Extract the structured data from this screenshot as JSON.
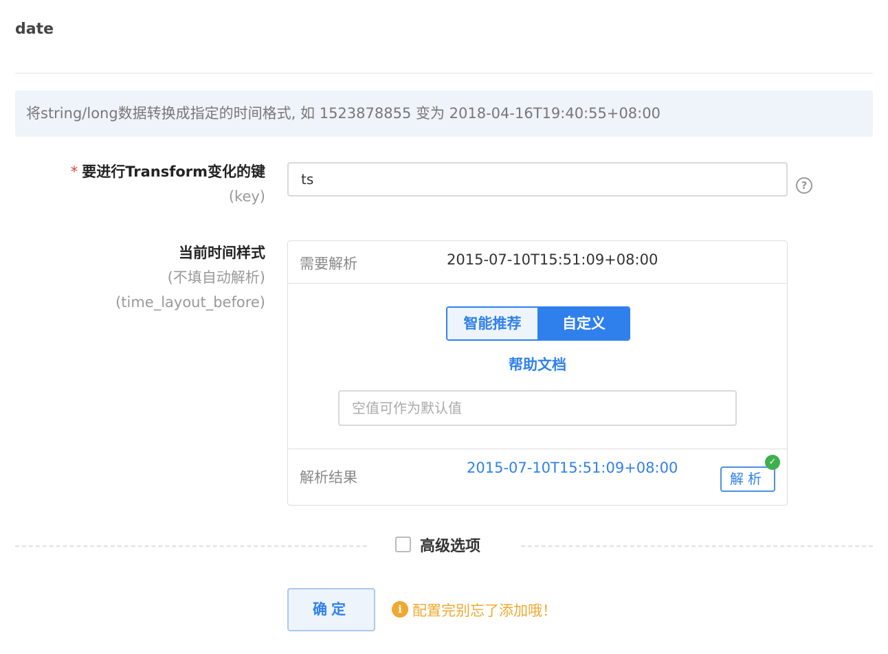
{
  "page": {
    "title": "date"
  },
  "info": {
    "text": "将string/long数据转换成指定的时间格式, 如 1523878855 变为 2018-04-16T19:40:55+08:00"
  },
  "key_field": {
    "required_mark": "*",
    "label": "要进行Transform变化的键",
    "sublabel": "(key)",
    "value": "ts",
    "help_icon": "question-circle-icon"
  },
  "layout_field": {
    "label": "当前时间样式",
    "sublabel1": "(不填自动解析)",
    "sublabel2": "(time_layout_before)",
    "parse_label": "需要解析",
    "parse_value": "2015-07-10T15:51:09+08:00",
    "tabs": [
      "智能推荐",
      "自定义"
    ],
    "active_tab": "自定义",
    "help_link": "帮助文档",
    "input_placeholder": "空值可作为默认值",
    "input_value": "",
    "result_label": "解析结果",
    "result_value": "2015-07-10T15:51:09+08:00",
    "parse_button": "解析",
    "success_icon": "check-circle-icon"
  },
  "advanced": {
    "label": "高级选项",
    "checked": false
  },
  "footer": {
    "confirm_label": "确定",
    "warning_icon": "info-circle-icon",
    "warning_text": "配置完别忘了添加哦！"
  },
  "colors": {
    "primary": "#2f80ed",
    "warning": "#f0a830",
    "success": "#3db04d",
    "required": "#e0403a"
  }
}
